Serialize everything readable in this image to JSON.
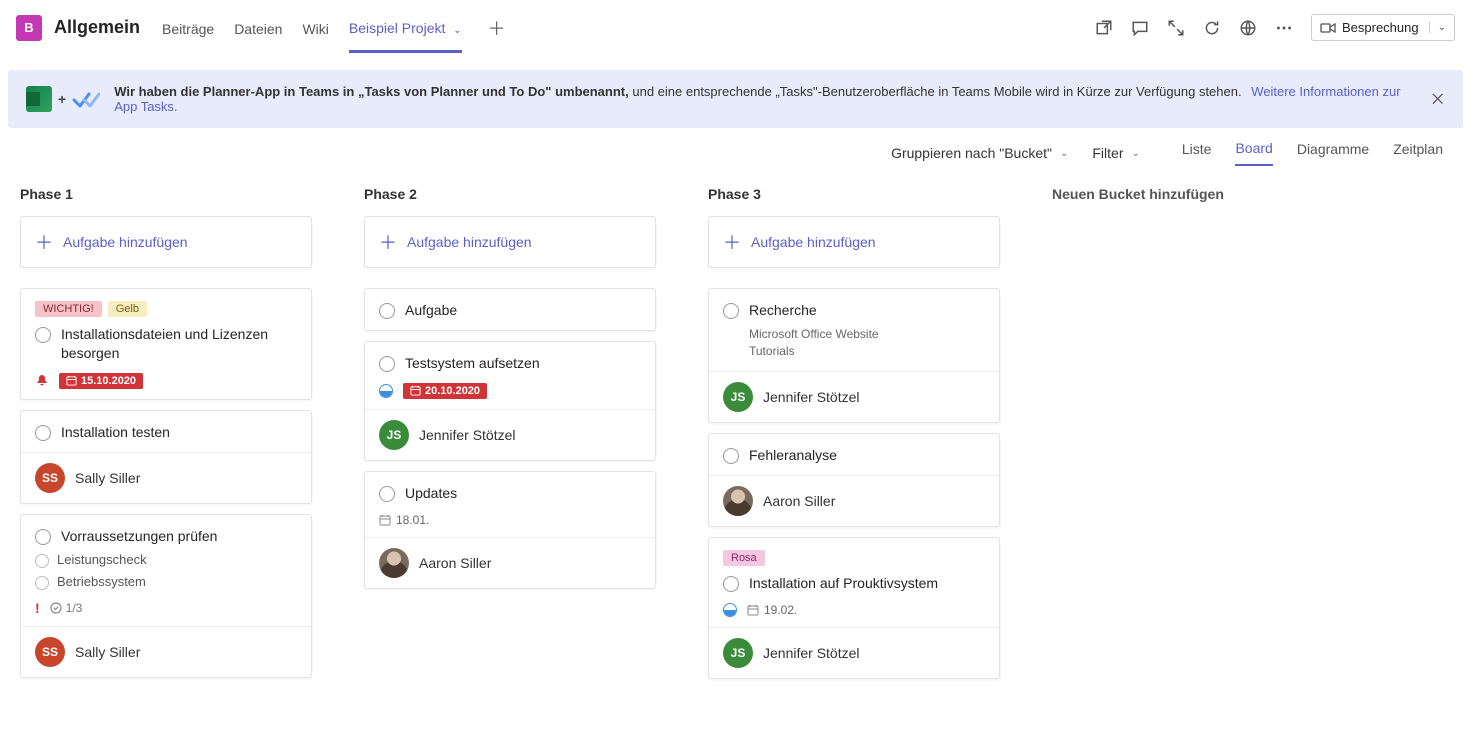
{
  "header": {
    "team_initial": "B",
    "channel": "Allgemein",
    "tabs": [
      "Beiträge",
      "Dateien",
      "Wiki"
    ],
    "active_tab": "Beispiel Projekt",
    "meeting_label": "Besprechung"
  },
  "banner": {
    "bold": "Wir haben die Planner-App in Teams in „Tasks von Planner und To Do\" umbenannt,",
    "rest": " und eine entsprechende „Tasks\"-Benutzeroberfläche in Teams Mobile wird in Kürze zur Verfügung stehen.",
    "link": "Weitere Informationen zur App Tasks."
  },
  "toolbar": {
    "group_label": "Gruppieren nach \"Bucket\"",
    "filter_label": "Filter",
    "views": {
      "list": "Liste",
      "board": "Board",
      "charts": "Diagramme",
      "schedule": "Zeitplan"
    }
  },
  "board": {
    "add_task_label": "Aufgabe hinzufügen",
    "new_bucket_label": "Neuen Bucket hinzufügen",
    "buckets": [
      {
        "name": "Phase 1",
        "cards": [
          {
            "labels": [
              {
                "text": "WICHTIG!",
                "cls": "lbl-red"
              },
              {
                "text": "Gelb",
                "cls": "lbl-yellow"
              }
            ],
            "title": "Installationsdateien und Lizenzen besorgen",
            "bell": true,
            "due_pill": "15.10.2020"
          },
          {
            "title": "Installation testen",
            "assignee": {
              "name": "Sally Siller",
              "initials": "SS",
              "cls": "av-ss"
            }
          },
          {
            "title": "Vorraussetzungen prüfen",
            "checklist": [
              "Leistungscheck",
              "Betriebssystem"
            ],
            "excl": true,
            "count": "1/3",
            "assignee": {
              "name": "Sally Siller",
              "initials": "SS",
              "cls": "av-ss"
            }
          }
        ]
      },
      {
        "name": "Phase 2",
        "cards": [
          {
            "title": "Aufgabe"
          },
          {
            "title": "Testsystem aufsetzen",
            "progress_half": true,
            "due_pill": "20.10.2020",
            "assignee": {
              "name": "Jennifer Stötzel",
              "initials": "JS",
              "cls": "av-js"
            }
          },
          {
            "title": "Updates",
            "due_plain": "18.01.",
            "assignee": {
              "name": "Aaron Siller",
              "img": true
            }
          }
        ]
      },
      {
        "name": "Phase 3",
        "cards": [
          {
            "title": "Recherche",
            "subtitle": "Microsoft Office Website\nTutorials",
            "assignee": {
              "name": "Jennifer Stötzel",
              "initials": "JS",
              "cls": "av-js"
            }
          },
          {
            "title": "Fehleranalyse",
            "assignee": {
              "name": "Aaron Siller",
              "img": true
            }
          },
          {
            "labels": [
              {
                "text": "Rosa",
                "cls": "lbl-pink"
              }
            ],
            "title": "Installation auf Prouktivsystem",
            "progress_half": true,
            "due_plain": "19.02.",
            "assignee": {
              "name": "Jennifer Stötzel",
              "initials": "JS",
              "cls": "av-js"
            }
          }
        ]
      }
    ]
  }
}
